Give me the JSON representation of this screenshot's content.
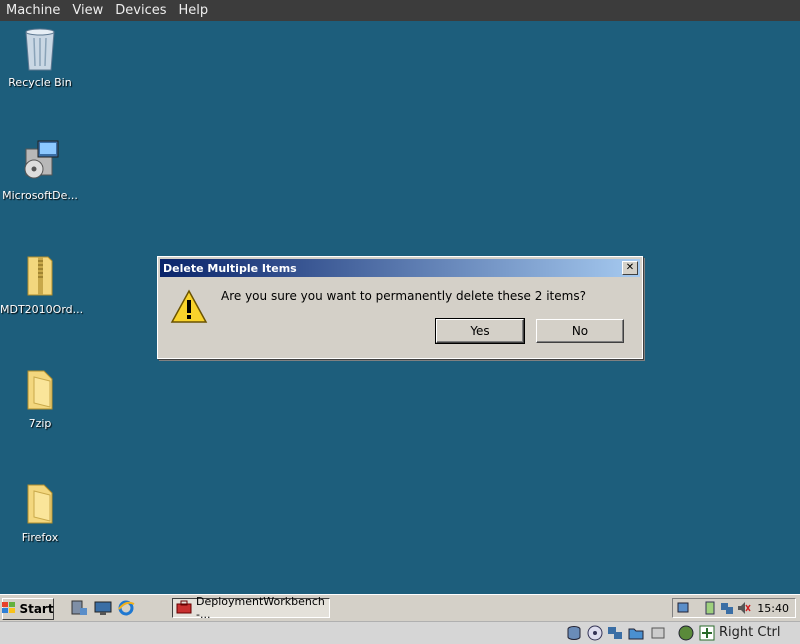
{
  "menubar": {
    "items": [
      {
        "label": "Machine"
      },
      {
        "label": "View"
      },
      {
        "label": "Devices"
      },
      {
        "label": "Help"
      }
    ]
  },
  "desktop": {
    "icons": [
      {
        "label": "Recycle Bin",
        "icon": "recycle-bin-icon"
      },
      {
        "label": "MicrosoftDe...",
        "icon": "installer-icon"
      },
      {
        "label": "MDT2010Ord...",
        "icon": "zip-folder-icon"
      },
      {
        "label": "7zip",
        "icon": "folder-icon"
      },
      {
        "label": "Firefox",
        "icon": "folder-icon"
      }
    ]
  },
  "dialog": {
    "title": "Delete Multiple Items",
    "message": "Are you sure you want to permanently delete these 2 items?",
    "yes_label": "Yes",
    "no_label": "No",
    "close_glyph": "✕"
  },
  "taskbar": {
    "start_label": "Start",
    "task_label": "DeploymentWorkbench -...",
    "clock": "15:40"
  },
  "statusbar": {
    "host_key": "Right Ctrl"
  },
  "colors": {
    "desktop": "#1d5e7c",
    "title_start": "#0a246a",
    "title_end": "#a6caf0"
  }
}
